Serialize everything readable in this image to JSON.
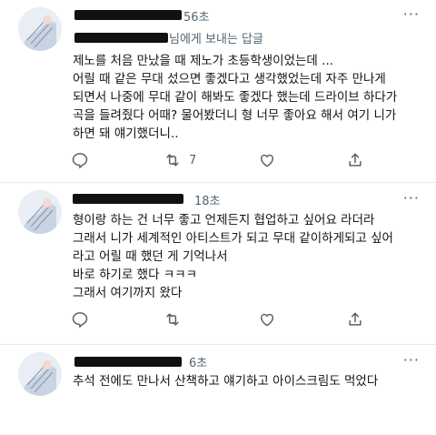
{
  "tweets": [
    {
      "time": "56초",
      "reply_suffix": "님에게 보내는 답글",
      "lines": [
        "제노를 처음 만났을 때 제노가 초등학생이었는데 ...",
        "어릴 때 같은 무대 섰으면 좋겠다고 생각했었는데 자주 만나게",
        "되면서 나중에 무대 같이 해봐도 좋겠다 했는데 드라이브 하다가",
        "곡을 들려줬다 어때? 물어봤더니 형 너무 좋아요 해서 여기 니가",
        "하면 돼 얘기했더니.."
      ],
      "retweet_count": "7"
    },
    {
      "time": "18초",
      "lines": [
        "형이랑 하는 건 너무 좋고 언제든지 협업하고 싶어요 라더라",
        "그래서 니가 세계적인 아티스트가 되고 무대 같이하게되고 싶어",
        "라고 어릴 때 했던 게 기억나서",
        "바로 하기로 했다 ㅋㅋㅋ",
        "그래서 여기까지 왔다"
      ]
    },
    {
      "time": "6초",
      "lines": [
        "추석 전에도 만나서 산책하고 얘기하고 아이스크림도 먹었다"
      ]
    }
  ],
  "more_icon": "more-icon",
  "action_icons": [
    "reply-icon",
    "retweet-icon",
    "like-icon",
    "share-icon"
  ]
}
